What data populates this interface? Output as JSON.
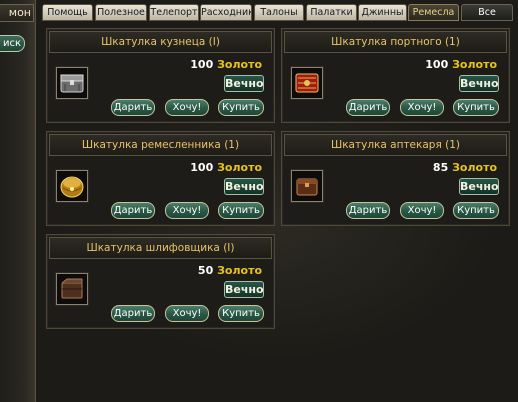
{
  "left_panel": {
    "tab_label": "мон",
    "button_label": "иск"
  },
  "tabs": [
    {
      "label": "Помощь",
      "active": false
    },
    {
      "label": "Полезное",
      "active": false
    },
    {
      "label": "Телепорт",
      "active": false
    },
    {
      "label": "Расходники",
      "active": false
    },
    {
      "label": "Талоны",
      "active": false
    },
    {
      "label": "Палатки",
      "active": false
    },
    {
      "label": "Джинны",
      "active": false
    },
    {
      "label": "Ремесла",
      "active": true
    },
    {
      "label": "Все",
      "active": false
    }
  ],
  "items": [
    {
      "title": "Шкатулка кузнеца (I)",
      "price": "100",
      "currency": "Золото",
      "duration": "Вечно",
      "icon": "blacksmith-box-icon",
      "color": "#8c8c8c"
    },
    {
      "title": "Шкатулка портного (1)",
      "price": "100",
      "currency": "Золото",
      "duration": "Вечно",
      "icon": "tailor-box-icon",
      "color": "#b3241c"
    },
    {
      "title": "Шкатулка ремесленника (1)",
      "price": "100",
      "currency": "Золото",
      "duration": "Вечно",
      "icon": "craftsman-box-icon",
      "color": "#c89a2a"
    },
    {
      "title": "Шкатулка аптекаря (1)",
      "price": "85",
      "currency": "Золото",
      "duration": "Вечно",
      "icon": "apothecary-box-icon",
      "color": "#6e3d1e"
    },
    {
      "title": "Шкатулка шлифовщика (I)",
      "price": "50",
      "currency": "Золото",
      "duration": "Вечно",
      "icon": "polisher-box-icon",
      "color": "#5e3a26"
    }
  ],
  "buttons": {
    "gift": "Дарить",
    "want": "Хочу!",
    "buy": "Купить"
  },
  "colors": {
    "title_gold": "#e8c46a",
    "currency_gold": "#e8c31c",
    "button_green": "#2b5a47",
    "background": "#1b1a16"
  }
}
